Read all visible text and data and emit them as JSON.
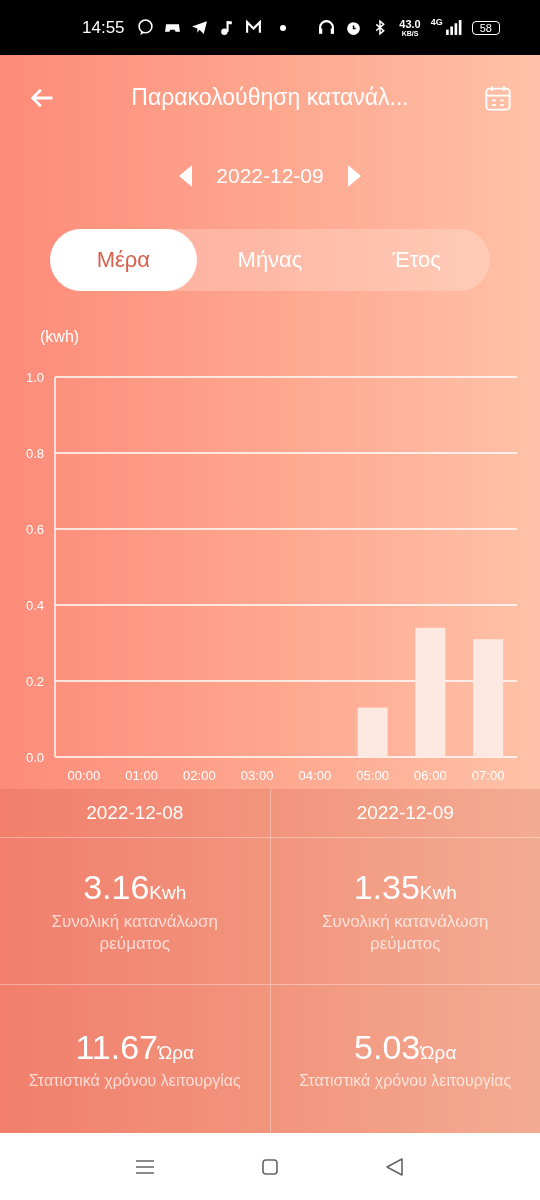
{
  "status_bar": {
    "time": "14:55",
    "speed": "43.0",
    "speed_unit": "KB/S",
    "network": "4G",
    "battery": "58"
  },
  "header": {
    "title": "Παρακολούθηση κατανάλ..."
  },
  "date_nav": {
    "date": "2022-12-09"
  },
  "tabs": [
    {
      "label": "Μέρα",
      "selected": true
    },
    {
      "label": "Μήνας",
      "selected": false
    },
    {
      "label": "Έτος",
      "selected": false
    }
  ],
  "chart": {
    "unit_label": "(kwh)",
    "chart_data": {
      "type": "bar",
      "categories": [
        "00:00",
        "01:00",
        "02:00",
        "03:00",
        "04:00",
        "05:00",
        "06:00",
        "07:00"
      ],
      "values": [
        0,
        0,
        0,
        0,
        0,
        0.13,
        0.34,
        0.31
      ],
      "ylim": [
        0,
        1
      ],
      "grid": true,
      "yticks": [
        {
          "value": 0,
          "label": "0.0"
        },
        {
          "value": 0.2,
          "label": "0.2"
        },
        {
          "value": 0.4,
          "label": "0.4"
        },
        {
          "value": 0.6,
          "label": "0.6"
        },
        {
          "value": 0.8,
          "label": "0.8"
        },
        {
          "value": 1,
          "label": "1.0"
        }
      ]
    }
  },
  "stats": [
    {
      "date": "2022-12-08",
      "consumption": "3.16",
      "consumption_unit": "Kwh",
      "consumption_label": "Συνολική κατανάλωση ρεύματος",
      "runtime": "11.67",
      "runtime_unit": "Ώρα",
      "runtime_label": "Στατιστικά χρόνου λειτουργίας"
    },
    {
      "date": "2022-12-09",
      "consumption": "1.35",
      "consumption_unit": "Kwh",
      "consumption_label": "Συνολική κατανάλωση ρεύματος",
      "runtime": "5.03",
      "runtime_unit": "Ώρα",
      "runtime_label": "Στατιστικά χρόνου λειτουργίας"
    }
  ]
}
